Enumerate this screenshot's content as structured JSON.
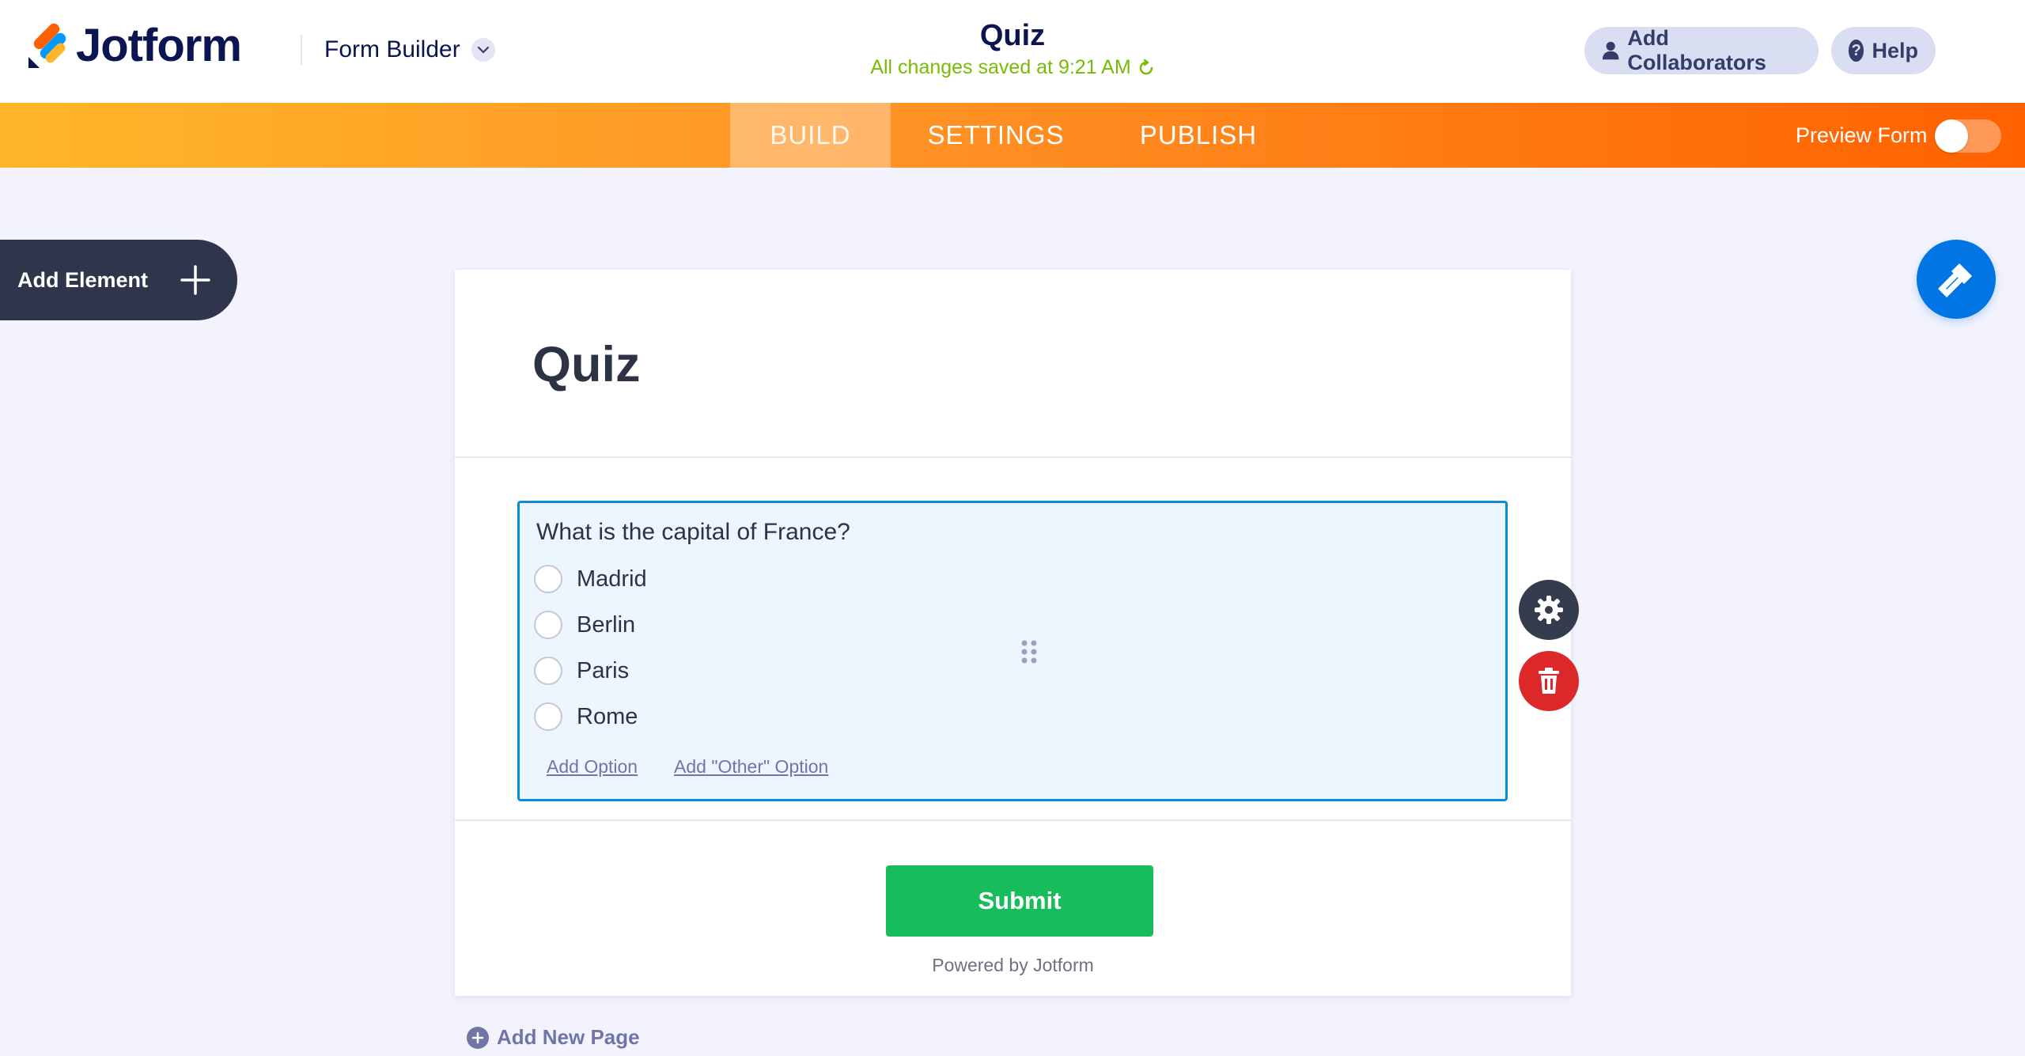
{
  "header": {
    "brand": "Jotform",
    "builder_menu": "Form Builder",
    "form_title": "Quiz",
    "saved_status": "All changes saved at 9:21 AM",
    "add_collaborators": "Add Collaborators",
    "help": "Help"
  },
  "nav": {
    "tabs": [
      {
        "label": "BUILD",
        "active": true
      },
      {
        "label": "SETTINGS",
        "active": false
      },
      {
        "label": "PUBLISH",
        "active": false
      }
    ],
    "preview_label": "Preview Form",
    "preview_enabled": false
  },
  "sidebar": {
    "add_element": "Add Element"
  },
  "form": {
    "heading": "Quiz",
    "question": {
      "label": "What is the capital of France?",
      "options": [
        "Madrid",
        "Berlin",
        "Paris",
        "Rome"
      ],
      "add_option": "Add Option",
      "add_other_option": "Add \"Other\" Option"
    },
    "submit_label": "Submit",
    "powered_by": "Powered by Jotform"
  },
  "footer": {
    "add_new_page": "Add New Page"
  },
  "colors": {
    "accent_orange": "#ff6100",
    "primary_blue": "#0075e3",
    "submit_green": "#18bd5b",
    "delete_red": "#dc2828",
    "saved_green": "#78bb07"
  }
}
